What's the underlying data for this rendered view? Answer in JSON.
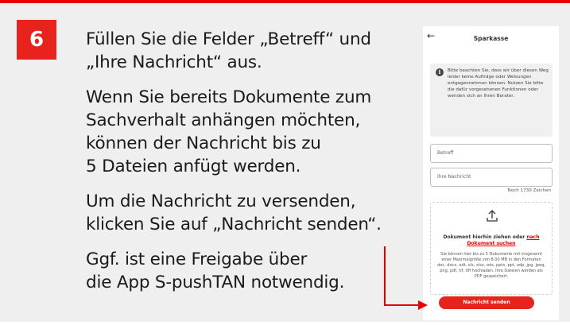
{
  "step": {
    "number": "6"
  },
  "instructions": [
    "Füllen Sie die Felder „Betreff“ und",
    "„Ihre Nachricht“ aus.",
    "Wenn Sie bereits Dokumente zum",
    "Sachverhalt anhängen möchten,",
    "können der Nachricht bis zu",
    "5 Dateien anfügt werden.",
    "Um die Nachricht zu versenden,",
    "klicken Sie auf „Nachricht senden“.",
    "Ggf. ist eine Freigabe über",
    "die App S-pushTAN notwendig."
  ],
  "colors": {
    "accent": "#e60000",
    "button": "#e8231e",
    "background": "#efefef"
  },
  "phone": {
    "title": "Sparkasse",
    "back_icon": "arrow-left-icon",
    "notice": "Bitte beachten Sie, dass wir über diesen Weg leider keine Aufträge oder Weisungen entgegennehmen können. Nutzen Sie bitte die dafür vorgesehenen Funktionen oder wenden sich an Ihren Berater.",
    "subject_placeholder": "Betreff",
    "message_placeholder": "Ihre Nachricht",
    "counter": "Noch 1730 Zeichen",
    "upload_prefix": "Dokument hierhin ziehen oder",
    "upload_link": "nach Dokument suchen",
    "upload_hint": "Sie können hier bis zu 5 Dokumente mit insgesamt einer Maximalgröße von 8.00 MB in den Formaten doc, docx, odt, xls, xlsx, ods, pptx, ppt, odp, jpg, jpeg, png, pdf, tif, tiff hochladen. Ihre Dateien werden als PDF gespeichert.",
    "send_label": "Nachricht senden"
  }
}
